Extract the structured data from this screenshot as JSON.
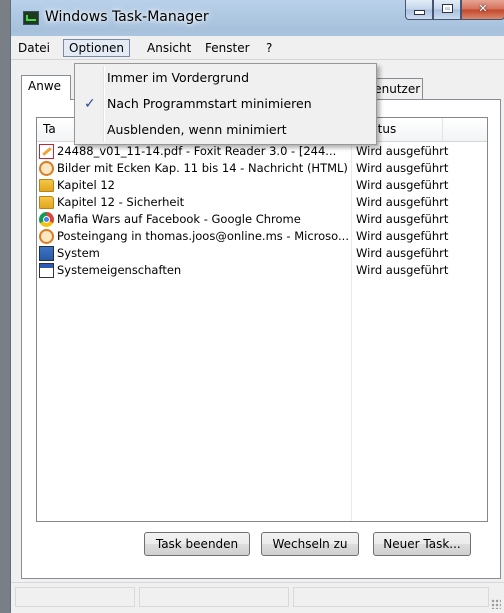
{
  "window": {
    "title": "Windows Task-Manager",
    "icon": "task-manager-icon"
  },
  "menubar": {
    "items": [
      "Datei",
      "Optionen",
      "Ansicht",
      "Fenster",
      "?"
    ],
    "open_menu": "Optionen"
  },
  "options_menu": {
    "items": [
      {
        "label": "Immer im Vordergrund",
        "checked": false
      },
      {
        "label": "Nach Programmstart minimieren",
        "checked": true
      },
      {
        "label": "Ausblenden, wenn minimiert",
        "checked": false
      }
    ],
    "check_glyph": "✓"
  },
  "tabs": [
    {
      "label": "Anwe"
    },
    {
      "label": "Benutzer"
    }
  ],
  "table": {
    "columns": [
      "Ta",
      "Status"
    ],
    "rows": [
      {
        "icon": "pdf-icon",
        "name": "24488_v01_11-14.pdf - Foxit Reader 3.0 - [244...",
        "status": "Wird ausgeführt"
      },
      {
        "icon": "html-icon",
        "name": "Bilder mit Ecken Kap. 11 bis 14 - Nachricht (HTML)",
        "status": "Wird ausgeführt"
      },
      {
        "icon": "folder-icon",
        "name": "Kapitel 12",
        "status": "Wird ausgeführt"
      },
      {
        "icon": "folder-icon",
        "name": "Kapitel 12 - Sicherheit",
        "status": "Wird ausgeführt"
      },
      {
        "icon": "chrome-icon",
        "name": "Mafia Wars auf Facebook - Google Chrome",
        "status": "Wird ausgeführt"
      },
      {
        "icon": "outlook-icon",
        "name": "Posteingang in thomas.joos@online.ms - Microso...",
        "status": "Wird ausgeführt"
      },
      {
        "icon": "system-icon",
        "name": "System",
        "status": "Wird ausgeführt"
      },
      {
        "icon": "window-icon",
        "name": "Systemeigenschaften",
        "status": "Wird ausgeführt"
      }
    ]
  },
  "buttons": {
    "end_task": "Task beenden",
    "switch_to": "Wechseln zu",
    "new_task": "Neuer Task..."
  }
}
